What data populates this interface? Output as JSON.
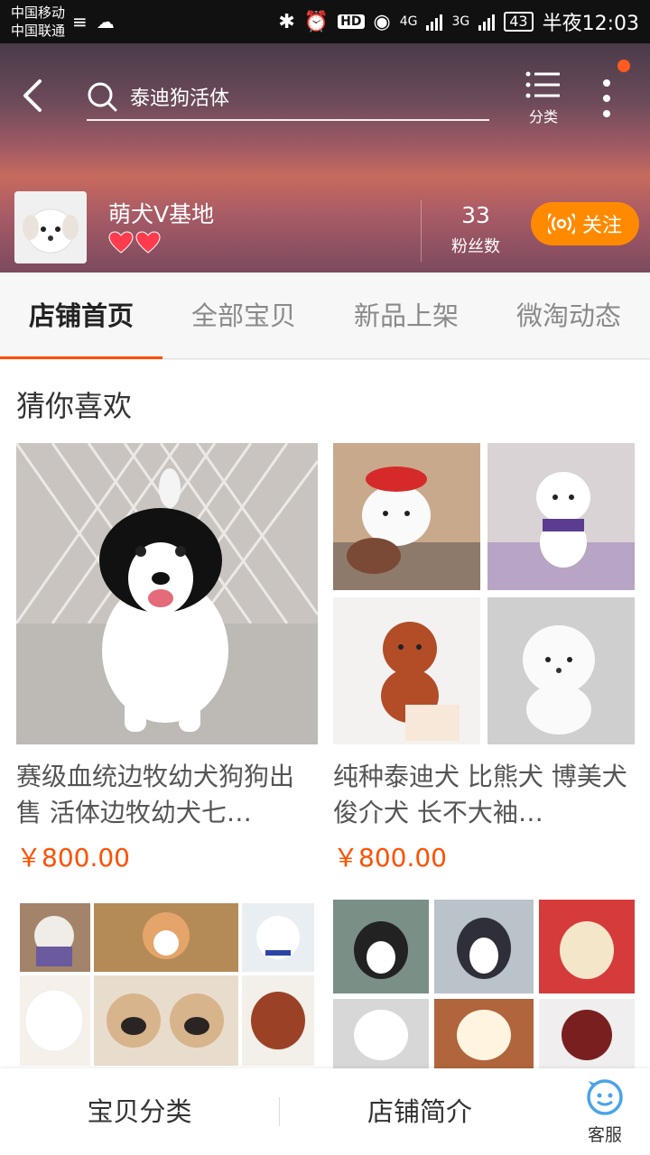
{
  "status_bar": {
    "carrier_1": "中国移动",
    "carrier_2": "中国联通",
    "network_1": "4G",
    "network_2": "3G",
    "hd": "HD",
    "battery": "43",
    "time": "半夜12:03"
  },
  "header": {
    "search_text": "泰迪狗活体",
    "category_label": "分类",
    "shop_name": "萌犬V基地",
    "fans_count": "33",
    "fans_label": "粉丝数",
    "follow_label": "关注"
  },
  "tabs": [
    {
      "label": "店铺首页",
      "active": true
    },
    {
      "label": "全部宝贝",
      "active": false
    },
    {
      "label": "新品上架",
      "active": false
    },
    {
      "label": "微淘动态",
      "active": false
    }
  ],
  "section": {
    "title": "猜你喜欢"
  },
  "products": [
    {
      "title": "赛级血统边牧幼犬狗狗出售 活体边牧幼犬七…",
      "price": "￥800.00"
    },
    {
      "title": "纯种泰迪犬 比熊犬 博美犬俊介犬 长不大袖…",
      "price": "￥800.00"
    }
  ],
  "bottom_bar": {
    "category_label": "宝贝分类",
    "intro_label": "店铺简介",
    "service_label": "客服"
  },
  "colors": {
    "accent": "#ff5000",
    "follow": "#ff8a00"
  }
}
